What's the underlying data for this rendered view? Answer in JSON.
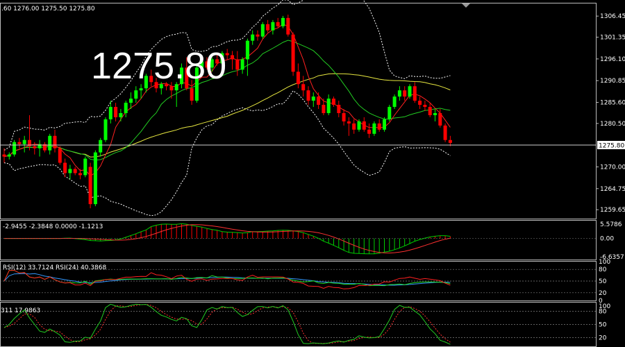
{
  "colors": {
    "background": "#000000",
    "bull": "#00ff00",
    "bear": "#ff0000",
    "border": "#bdbdbd",
    "text": "#ffffff",
    "grid": "#808080",
    "ma_slow": "#e8e840",
    "ma_mid": "#22cc22",
    "ma_fast": "#ff2020",
    "bands": "#ffffff",
    "macd_hist": "#ff0000",
    "macd_hist_neg": "#00cc00",
    "macd_signal": "#ff3030",
    "macd_line": "#00cc00",
    "rsi_fast": "#ff2020",
    "rsi_mid": "#22dd22",
    "rsi_slow": "#3399ff",
    "kd_k": "#22cc22",
    "kd_d": "#ff3030"
  },
  "main": {
    "header": ".60 1276.00 1275.50 1275.80",
    "big_price": "1275.80",
    "last_price_label": "1275.80",
    "axis_labels": [
      "1306.45",
      "1301.35",
      "1296.10",
      "1290.85",
      "1285.60",
      "1280.50",
      "1270.00",
      "1264.75",
      "1259.65"
    ]
  },
  "macd": {
    "header": "-2.9455 -2.3848 0.0000 -1.1213",
    "axis_labels": [
      "5.5786",
      "0.00",
      "-6.6357"
    ]
  },
  "rsi": {
    "header": "RSI(12) 33.7124  RSI(24) 40.3868",
    "axis_labels": [
      "100",
      "80",
      "50",
      "20",
      "0"
    ]
  },
  "kd": {
    "header": "311 17.9863",
    "axis_labels": [
      "100",
      "80",
      "50",
      "20"
    ]
  },
  "chart_data": {
    "type": "candlestick",
    "y_range": [
      1257.5,
      1309.5
    ],
    "ohlc": [
      [
        1273.0,
        1274.5,
        1271.0,
        1272.5
      ],
      [
        1272.5,
        1273.5,
        1271.8,
        1273.0
      ],
      [
        1273.0,
        1276.5,
        1272.5,
        1276.0
      ],
      [
        1276.0,
        1277.0,
        1274.5,
        1275.5
      ],
      [
        1275.5,
        1277.5,
        1273.5,
        1276.5
      ],
      [
        1276.5,
        1282.5,
        1274.0,
        1275.0
      ],
      [
        1275.0,
        1276.0,
        1273.0,
        1274.5
      ],
      [
        1274.5,
        1276.5,
        1272.5,
        1275.5
      ],
      [
        1275.5,
        1276.0,
        1273.5,
        1274.0
      ],
      [
        1274.0,
        1278.0,
        1273.0,
        1277.5
      ],
      [
        1277.5,
        1279.0,
        1273.5,
        1274.5
      ],
      [
        1274.5,
        1275.0,
        1270.5,
        1271.0
      ],
      [
        1271.0,
        1272.0,
        1267.5,
        1268.5
      ],
      [
        1268.5,
        1270.5,
        1267.0,
        1269.5
      ],
      [
        1269.5,
        1270.0,
        1268.0,
        1268.5
      ],
      [
        1268.5,
        1269.5,
        1267.0,
        1268.0
      ],
      [
        1268.0,
        1272.5,
        1267.5,
        1272.0
      ],
      [
        1270.0,
        1271.0,
        1260.0,
        1261.0
      ],
      [
        1261.0,
        1274.0,
        1260.5,
        1273.5
      ],
      [
        1273.5,
        1277.0,
        1272.5,
        1276.5
      ],
      [
        1276.5,
        1282.0,
        1276.0,
        1281.5
      ],
      [
        1281.5,
        1286.0,
        1280.5,
        1284.5
      ],
      [
        1284.5,
        1285.5,
        1281.0,
        1282.0
      ],
      [
        1282.0,
        1284.0,
        1281.0,
        1283.0
      ],
      [
        1283.0,
        1286.0,
        1282.0,
        1285.5
      ],
      [
        1285.5,
        1288.0,
        1284.0,
        1286.5
      ],
      [
        1286.5,
        1289.5,
        1285.5,
        1288.5
      ],
      [
        1288.5,
        1290.0,
        1286.5,
        1289.0
      ],
      [
        1289.0,
        1292.5,
        1288.0,
        1292.0
      ],
      [
        1292.0,
        1293.5,
        1289.5,
        1290.5
      ],
      [
        1290.5,
        1291.5,
        1288.0,
        1289.0
      ],
      [
        1289.0,
        1290.5,
        1287.5,
        1290.0
      ],
      [
        1290.0,
        1290.5,
        1288.5,
        1289.5
      ],
      [
        1289.5,
        1290.5,
        1286.5,
        1288.5
      ],
      [
        1288.5,
        1290.5,
        1284.5,
        1290.0
      ],
      [
        1290.0,
        1295.0,
        1289.0,
        1294.0
      ],
      [
        1294.0,
        1296.5,
        1288.5,
        1289.0
      ],
      [
        1289.0,
        1291.0,
        1285.0,
        1286.0
      ],
      [
        1286.0,
        1294.5,
        1285.5,
        1294.0
      ],
      [
        1294.0,
        1296.0,
        1292.0,
        1295.5
      ],
      [
        1295.5,
        1296.5,
        1293.5,
        1294.0
      ],
      [
        1294.0,
        1296.5,
        1293.0,
        1296.0
      ],
      [
        1296.0,
        1297.5,
        1294.5,
        1295.0
      ],
      [
        1295.0,
        1298.0,
        1294.0,
        1297.5
      ],
      [
        1297.5,
        1298.5,
        1296.0,
        1297.0
      ],
      [
        1297.0,
        1298.0,
        1293.5,
        1296.0
      ],
      [
        1296.0,
        1298.0,
        1292.0,
        1293.5
      ],
      [
        1293.5,
        1296.5,
        1292.5,
        1296.0
      ],
      [
        1296.0,
        1301.0,
        1292.0,
        1300.5
      ],
      [
        1300.5,
        1303.0,
        1299.5,
        1302.0
      ],
      [
        1302.0,
        1303.0,
        1300.5,
        1301.5
      ],
      [
        1301.5,
        1305.0,
        1301.0,
        1304.5
      ],
      [
        1304.5,
        1305.5,
        1302.5,
        1303.0
      ],
      [
        1303.0,
        1305.5,
        1302.0,
        1305.0
      ],
      [
        1305.0,
        1306.0,
        1303.5,
        1304.0
      ],
      [
        1304.0,
        1306.5,
        1303.5,
        1306.0
      ],
      [
        1306.0,
        1306.8,
        1301.5,
        1302.0
      ],
      [
        1302.0,
        1302.5,
        1292.0,
        1293.0
      ],
      [
        1293.0,
        1295.0,
        1289.0,
        1290.0
      ],
      [
        1290.0,
        1292.0,
        1287.0,
        1288.5
      ],
      [
        1288.5,
        1289.5,
        1285.0,
        1286.0
      ],
      [
        1286.0,
        1288.0,
        1284.5,
        1287.0
      ],
      [
        1287.0,
        1288.0,
        1284.0,
        1285.0
      ],
      [
        1285.0,
        1286.5,
        1282.5,
        1283.0
      ],
      [
        1283.0,
        1287.5,
        1282.5,
        1286.5
      ],
      [
        1286.5,
        1287.0,
        1284.5,
        1285.0
      ],
      [
        1285.0,
        1286.0,
        1282.0,
        1283.0
      ],
      [
        1283.0,
        1284.0,
        1280.0,
        1281.0
      ],
      [
        1281.0,
        1282.0,
        1277.5,
        1280.5
      ],
      [
        1280.5,
        1281.5,
        1278.0,
        1279.0
      ],
      [
        1279.0,
        1281.5,
        1278.5,
        1281.0
      ],
      [
        1281.0,
        1282.0,
        1278.5,
        1279.0
      ],
      [
        1279.0,
        1280.5,
        1277.0,
        1278.0
      ],
      [
        1278.0,
        1281.0,
        1277.5,
        1280.5
      ],
      [
        1280.5,
        1281.5,
        1278.5,
        1279.0
      ],
      [
        1279.0,
        1282.0,
        1278.5,
        1281.5
      ],
      [
        1281.5,
        1285.0,
        1281.0,
        1284.5
      ],
      [
        1284.5,
        1287.5,
        1284.0,
        1287.0
      ],
      [
        1287.0,
        1289.5,
        1286.0,
        1288.5
      ],
      [
        1288.5,
        1289.5,
        1286.0,
        1287.0
      ],
      [
        1287.0,
        1290.0,
        1286.5,
        1289.5
      ],
      [
        1289.5,
        1290.5,
        1285.5,
        1286.0
      ],
      [
        1286.0,
        1287.0,
        1284.0,
        1285.0
      ],
      [
        1285.0,
        1286.0,
        1283.5,
        1284.5
      ],
      [
        1284.5,
        1285.5,
        1282.0,
        1282.5
      ],
      [
        1282.5,
        1284.0,
        1281.0,
        1283.0
      ],
      [
        1283.0,
        1284.0,
        1279.5,
        1280.0
      ],
      [
        1280.0,
        1280.5,
        1276.0,
        1276.5
      ],
      [
        1276.5,
        1277.5,
        1275.0,
        1275.8
      ]
    ]
  }
}
